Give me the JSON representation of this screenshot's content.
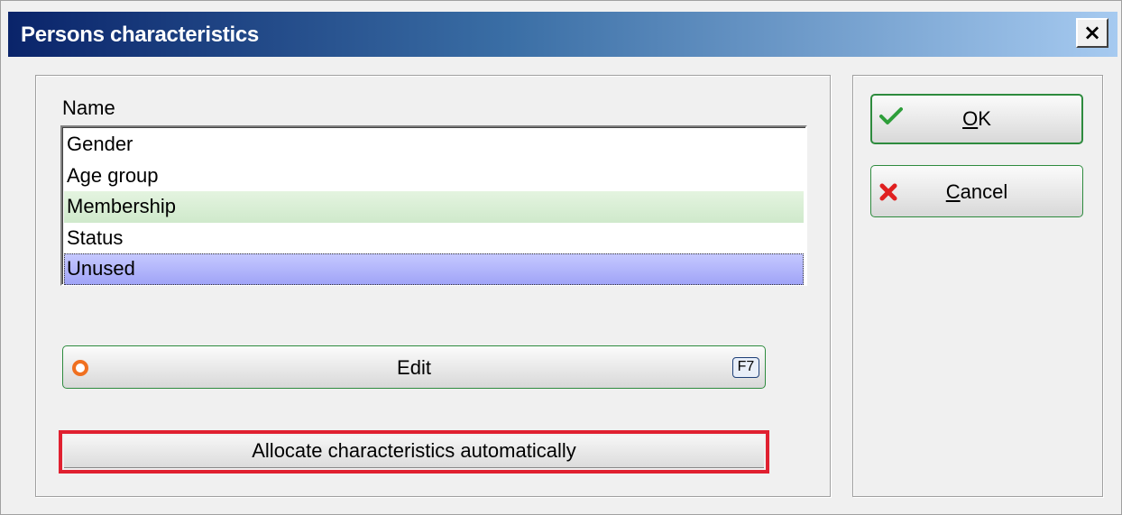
{
  "window": {
    "title": "Persons characteristics",
    "close_label": "×"
  },
  "list": {
    "header": "Name",
    "items": [
      {
        "label": "Gender",
        "state": "normal"
      },
      {
        "label": "Age group",
        "state": "normal"
      },
      {
        "label": "Membership",
        "state": "highlighted"
      },
      {
        "label": "Status",
        "state": "normal"
      },
      {
        "label": "Unused",
        "state": "selected"
      }
    ]
  },
  "buttons": {
    "ok_label": "OK",
    "ok_mnemonic": "O",
    "ok_rest": "K",
    "cancel_label": "Cancel",
    "cancel_mnemonic": "C",
    "cancel_rest": "ancel",
    "edit_label": "Edit",
    "edit_shortcut": "F7",
    "allocate_label": "Allocate characteristics automatically"
  },
  "colors": {
    "title_gradient_start": "#0a246a",
    "title_gradient_end": "#a6caf0",
    "button_border": "#2e8b3e",
    "highlight_border": "#e02030",
    "selected_row": "#9fa3f7",
    "green_row": "#cfe9cb",
    "ok_check": "#2e9e3a",
    "cancel_x": "#e02020",
    "edit_ring": "#f07020"
  },
  "icons": {
    "ok": "checkmark-icon",
    "cancel": "x-mark-icon",
    "edit": "orange-ring-icon",
    "close": "close-icon"
  }
}
